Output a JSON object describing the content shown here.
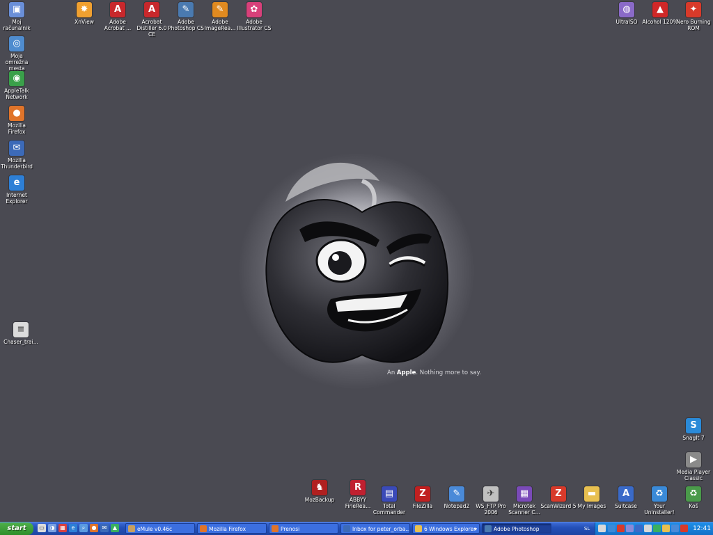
{
  "desktop": {
    "left_icons": [
      {
        "label": "Moj računalnik",
        "icon": "computer-icon",
        "color": "#6a8fd8",
        "glyph": "▣"
      },
      {
        "label": "Moja omrežna mesta",
        "icon": "network-places-icon",
        "color": "#4f8ccf",
        "glyph": "◎"
      },
      {
        "label": "AppleTalk Network",
        "icon": "globe-icon",
        "color": "#3aa04a",
        "glyph": "◉"
      },
      {
        "label": "Mozilla Firefox",
        "icon": "firefox-icon",
        "color": "#e0742a",
        "glyph": "●"
      },
      {
        "label": "Mozilla Thunderbird",
        "icon": "thunderbird-icon",
        "color": "#3c6ab8",
        "glyph": "✉"
      },
      {
        "label": "Internet Explorer",
        "icon": "internet-explorer-icon",
        "color": "#2d7fd6",
        "glyph": "e"
      },
      {
        "label": "Chaser_trai...",
        "icon": "document-icon",
        "color": "#dcdcdc",
        "glyph": "≡"
      }
    ],
    "top_icons": [
      {
        "label": "XnView",
        "icon": "xnview-icon",
        "color": "#f0a030",
        "glyph": "✸"
      },
      {
        "label": "Adobe Acrobat ...",
        "icon": "acrobat-icon",
        "color": "#c8282c",
        "glyph": "A"
      },
      {
        "label": "Acrobat Distiller 6.0 CE",
        "icon": "distiller-icon",
        "color": "#c8282c",
        "glyph": "A"
      },
      {
        "label": "Adobe Photoshop CS",
        "icon": "photoshop-icon",
        "color": "#4a7ab0",
        "glyph": "✎"
      },
      {
        "label": "Adobe ImageRea...",
        "icon": "imageready-icon",
        "color": "#e08a20",
        "glyph": "✎"
      },
      {
        "label": "Adobe Illustrator CS",
        "icon": "illustrator-icon",
        "color": "#d8407a",
        "glyph": "✿"
      }
    ],
    "topright_icons": [
      {
        "label": "UltraISO",
        "icon": "ultraiso-icon",
        "color": "#8a6ac8",
        "glyph": "◍"
      },
      {
        "label": "Alcohol 120%",
        "icon": "alcohol-icon",
        "color": "#d02828",
        "glyph": "▲"
      },
      {
        "label": "Nero Burning ROM",
        "icon": "nero-icon",
        "color": "#d83a2a",
        "glyph": "✦"
      }
    ],
    "right_icons": [
      {
        "label": "SnagIt 7",
        "icon": "snagit-icon",
        "color": "#2a8ad8",
        "glyph": "S"
      },
      {
        "label": "Media Player Classic",
        "icon": "media-player-icon",
        "color": "#8a8a8a",
        "glyph": "▶"
      }
    ],
    "bottom_icons": [
      {
        "label": "MozBackup",
        "icon": "mozbackup-icon",
        "color": "#b02020",
        "glyph": "♞"
      },
      {
        "label": "ABBYY FineRea...",
        "icon": "abbyy-icon",
        "color": "#c02030",
        "glyph": "R"
      },
      {
        "label": "Total Commander",
        "icon": "total-commander-icon",
        "color": "#3a4ab8",
        "glyph": "▤"
      },
      {
        "label": "FileZilla",
        "icon": "filezilla-icon",
        "color": "#c02020",
        "glyph": "Z"
      },
      {
        "label": "Notepad2",
        "icon": "notepad-icon",
        "color": "#4a8ad8",
        "glyph": "✎"
      },
      {
        "label": "WS_FTP Pro 2006",
        "icon": "wsftp-icon",
        "color": "#c0c0c0",
        "glyph": "✈"
      },
      {
        "label": "Microtek Scanner C...",
        "icon": "scanner-icon",
        "color": "#7a4ab8",
        "glyph": "▦"
      },
      {
        "label": "ScanWizard 5",
        "icon": "scanwizard-icon",
        "color": "#d83a2a",
        "glyph": "Z"
      },
      {
        "label": "My Images",
        "icon": "folder-icon",
        "color": "#e8c050",
        "glyph": "▬"
      },
      {
        "label": "Suitcase",
        "icon": "suitcase-icon",
        "color": "#3a6ac8",
        "glyph": "A"
      },
      {
        "label": "Your Uninstaller!",
        "icon": "uninstaller-icon",
        "color": "#3a8ad8",
        "glyph": "♻"
      },
      {
        "label": "Koš",
        "icon": "recycle-bin-icon",
        "color": "#4a9a4a",
        "glyph": "♻"
      }
    ]
  },
  "wallpaper": {
    "tagline_pre": "An",
    "tagline_brand": "Apple",
    "tagline_post": ". Nothing more to say."
  },
  "taskbar": {
    "start_label": "start",
    "quick_launch": [
      {
        "icon": "show-desktop-icon",
        "color": "#dcdcdc"
      },
      {
        "icon": "explorer-icon",
        "color": "#7aa0e0"
      },
      {
        "icon": "calculator-icon",
        "color": "#d84040"
      },
      {
        "icon": "ie-icon",
        "color": "#2d7fd6"
      },
      {
        "icon": "search-icon",
        "color": "#5a9ae0"
      },
      {
        "icon": "firefox-ql-icon",
        "color": "#e0742a"
      },
      {
        "icon": "thunderbird-ql-icon",
        "color": "#3c6ab8"
      },
      {
        "icon": "sail-icon",
        "color": "#3ab060"
      }
    ],
    "tasks": [
      {
        "label": "eMule v0.46c",
        "icon": "emule-icon",
        "color": "#c8a060",
        "active": false
      },
      {
        "label": "Mozilla Firefox",
        "icon": "firefox-task-icon",
        "color": "#e0742a",
        "active": false
      },
      {
        "label": "Prenosi",
        "icon": "downloads-icon",
        "color": "#e0742a",
        "active": false
      },
      {
        "label": "Inbox for peter_orba...",
        "icon": "mail-icon",
        "color": "#3c6ab8",
        "active": false
      },
      {
        "label": "6 Windows Explorer",
        "icon": "explorer-folder-icon",
        "color": "#e8c050",
        "active": false
      },
      {
        "label": "Adobe Photoshop",
        "icon": "photoshop-task-icon",
        "color": "#4a7ab0",
        "active": true
      }
    ],
    "language": "SL",
    "tray_icons": [
      "#d8d8d8",
      "#3a8ad8",
      "#d83a2a",
      "#8a8ad8",
      "#3a6ac8",
      "#d8d8d8",
      "#3ab060",
      "#e8c050",
      "#4a8ad8",
      "#d83a2a"
    ],
    "clock": "12:41"
  }
}
